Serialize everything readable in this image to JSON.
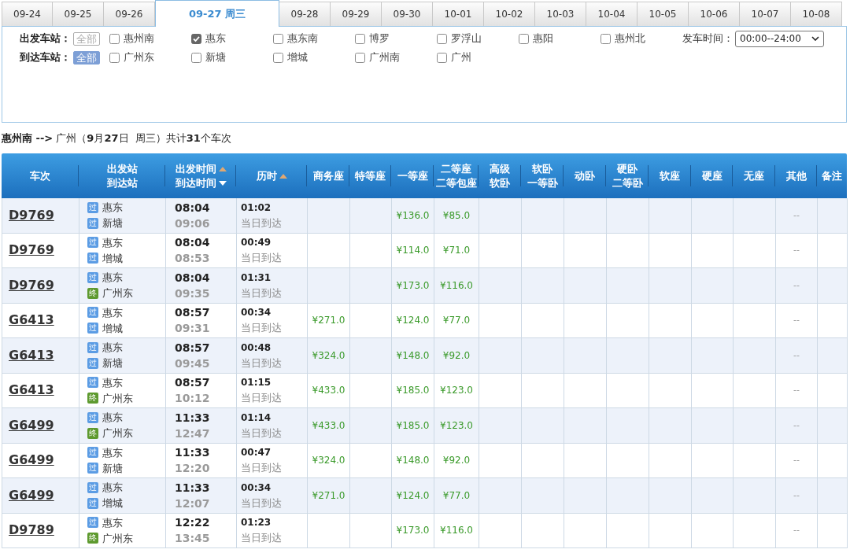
{
  "date_tabs": [
    {
      "label": "09-24",
      "selected": false
    },
    {
      "label": "09-25",
      "selected": false
    },
    {
      "label": "09-26",
      "selected": false
    },
    {
      "label": "09-27 周三",
      "selected": true
    },
    {
      "label": "09-28",
      "selected": false
    },
    {
      "label": "09-29",
      "selected": false
    },
    {
      "label": "09-30",
      "selected": false
    },
    {
      "label": "10-01",
      "selected": false
    },
    {
      "label": "10-02",
      "selected": false
    },
    {
      "label": "10-03",
      "selected": false
    },
    {
      "label": "10-04",
      "selected": false
    },
    {
      "label": "10-05",
      "selected": false
    },
    {
      "label": "10-06",
      "selected": false
    },
    {
      "label": "10-07",
      "selected": false
    },
    {
      "label": "10-08",
      "selected": false
    }
  ],
  "filters": {
    "departure": {
      "label": "出发车站：",
      "all": {
        "label": "全部",
        "selected": false
      },
      "stations": [
        {
          "label": "惠州南",
          "checked": false
        },
        {
          "label": "惠东",
          "checked": true
        },
        {
          "label": "惠东南",
          "checked": false
        },
        {
          "label": "博罗",
          "checked": false
        },
        {
          "label": "罗浮山",
          "checked": false
        },
        {
          "label": "惠阳",
          "checked": false
        },
        {
          "label": "惠州北",
          "checked": false
        }
      ]
    },
    "arrival": {
      "label": "到达车站：",
      "all": {
        "label": "全部",
        "selected": true
      },
      "stations": [
        {
          "label": "广州东",
          "checked": false
        },
        {
          "label": "新塘",
          "checked": false
        },
        {
          "label": "增城",
          "checked": false
        },
        {
          "label": "广州南",
          "checked": false
        },
        {
          "label": "广州",
          "checked": false
        }
      ]
    },
    "time": {
      "label": "发车时间：",
      "value": "00:00--24:00"
    }
  },
  "summary": "**惠州南 -->** 广州（**9**月**27**日  周三）共计**31**个车次",
  "table": {
    "columns": [
      {
        "lines": [
          {
            "text": "车次"
          }
        ]
      },
      {
        "lines": [
          {
            "text": "出发站"
          },
          {
            "text": "到达站"
          }
        ]
      },
      {
        "lines": [
          {
            "text": "出发时间",
            "sort": {
              "descending": false,
              "active": false
            }
          },
          {
            "text": "到达时间",
            "sort": {
              "descending": true,
              "active": true
            }
          }
        ]
      },
      {
        "lines": [
          {
            "text": "历时",
            "sort": {
              "descending": false,
              "active": false
            }
          }
        ]
      },
      {
        "lines": [
          {
            "text": "商务座"
          }
        ]
      },
      {
        "lines": [
          {
            "text": "特等座"
          }
        ]
      },
      {
        "lines": [
          {
            "text": "一等座"
          }
        ]
      },
      {
        "lines": [
          {
            "text": "二等座"
          },
          {
            "text": "二等包座"
          }
        ]
      },
      {
        "lines": [
          {
            "text": "高级"
          },
          {
            "text": "软卧"
          }
        ]
      },
      {
        "lines": [
          {
            "text": "软卧"
          },
          {
            "text": "一等卧"
          }
        ]
      },
      {
        "lines": [
          {
            "text": "动卧"
          }
        ]
      },
      {
        "lines": [
          {
            "text": "硬卧"
          },
          {
            "text": "二等卧"
          }
        ]
      },
      {
        "lines": [
          {
            "text": "软座"
          }
        ]
      },
      {
        "lines": [
          {
            "text": "硬座"
          }
        ]
      },
      {
        "lines": [
          {
            "text": "无座"
          }
        ]
      },
      {
        "lines": [
          {
            "text": "其他"
          }
        ]
      },
      {
        "lines": [
          {
            "text": "备注"
          }
        ]
      }
    ],
    "rows": [
      {
        "train": "D9769",
        "from": {
          "kind": "pass",
          "tag": "过",
          "name": "惠东"
        },
        "to": {
          "kind": "pass",
          "tag": "过",
          "name": "新塘"
        },
        "depart": "08:04",
        "arrive": "09:06",
        "duration": "01:02",
        "arrival_day": "当日到达",
        "first": "¥136.0",
        "second": "¥85.0",
        "other": "--"
      },
      {
        "train": "D9769",
        "from": {
          "kind": "pass",
          "tag": "过",
          "name": "惠东"
        },
        "to": {
          "kind": "pass",
          "tag": "过",
          "name": "增城"
        },
        "depart": "08:04",
        "arrive": "08:53",
        "duration": "00:49",
        "arrival_day": "当日到达",
        "first": "¥114.0",
        "second": "¥71.0",
        "other": "--"
      },
      {
        "train": "D9769",
        "from": {
          "kind": "pass",
          "tag": "过",
          "name": "惠东"
        },
        "to": {
          "kind": "end",
          "tag": "终",
          "name": "广州东"
        },
        "depart": "08:04",
        "arrive": "09:35",
        "duration": "01:31",
        "arrival_day": "当日到达",
        "first": "¥173.0",
        "second": "¥116.0",
        "other": "--"
      },
      {
        "train": "G6413",
        "from": {
          "kind": "pass",
          "tag": "过",
          "name": "惠东"
        },
        "to": {
          "kind": "pass",
          "tag": "过",
          "name": "增城"
        },
        "depart": "08:57",
        "arrive": "09:31",
        "duration": "00:34",
        "arrival_day": "当日到达",
        "business": "¥271.0",
        "first": "¥124.0",
        "second": "¥77.0",
        "other": "--"
      },
      {
        "train": "G6413",
        "from": {
          "kind": "pass",
          "tag": "过",
          "name": "惠东"
        },
        "to": {
          "kind": "pass",
          "tag": "过",
          "name": "新塘"
        },
        "depart": "08:57",
        "arrive": "09:45",
        "duration": "00:48",
        "arrival_day": "当日到达",
        "business": "¥324.0",
        "first": "¥148.0",
        "second": "¥92.0",
        "other": "--"
      },
      {
        "train": "G6413",
        "from": {
          "kind": "pass",
          "tag": "过",
          "name": "惠东"
        },
        "to": {
          "kind": "end",
          "tag": "终",
          "name": "广州东"
        },
        "depart": "08:57",
        "arrive": "10:12",
        "duration": "01:15",
        "arrival_day": "当日到达",
        "business": "¥433.0",
        "first": "¥185.0",
        "second": "¥123.0",
        "other": "--"
      },
      {
        "train": "G6499",
        "from": {
          "kind": "pass",
          "tag": "过",
          "name": "惠东"
        },
        "to": {
          "kind": "end",
          "tag": "终",
          "name": "广州东"
        },
        "depart": "11:33",
        "arrive": "12:47",
        "duration": "01:14",
        "arrival_day": "当日到达",
        "business": "¥433.0",
        "first": "¥185.0",
        "second": "¥123.0",
        "other": "--"
      },
      {
        "train": "G6499",
        "from": {
          "kind": "pass",
          "tag": "过",
          "name": "惠东"
        },
        "to": {
          "kind": "pass",
          "tag": "过",
          "name": "新塘"
        },
        "depart": "11:33",
        "arrive": "12:20",
        "duration": "00:47",
        "arrival_day": "当日到达",
        "business": "¥324.0",
        "first": "¥148.0",
        "second": "¥92.0",
        "other": "--"
      },
      {
        "train": "G6499",
        "from": {
          "kind": "pass",
          "tag": "过",
          "name": "惠东"
        },
        "to": {
          "kind": "pass",
          "tag": "过",
          "name": "增城"
        },
        "depart": "11:33",
        "arrive": "12:07",
        "duration": "00:34",
        "arrival_day": "当日到达",
        "business": "¥271.0",
        "first": "¥124.0",
        "second": "¥77.0",
        "other": "--"
      },
      {
        "train": "D9789",
        "from": {
          "kind": "pass",
          "tag": "过",
          "name": "惠东"
        },
        "to": {
          "kind": "end",
          "tag": "终",
          "name": "广州东"
        },
        "depart": "12:22",
        "arrive": "13:45",
        "duration": "01:23",
        "arrival_day": "当日到达",
        "first": "¥173.0",
        "second": "¥116.0",
        "other": "--"
      }
    ]
  }
}
